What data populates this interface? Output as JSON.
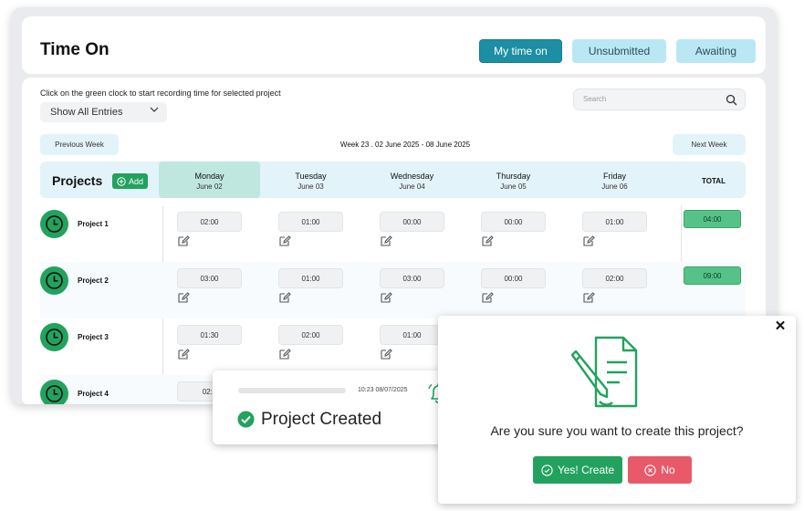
{
  "header": {
    "title": "Time On",
    "tabs": [
      {
        "label": "My time on",
        "active": true
      },
      {
        "label": "Unsubmitted",
        "active": false
      },
      {
        "label": "Awaiting",
        "active": false
      }
    ]
  },
  "toolbar": {
    "hint": "Click on the green clock to start recording time for selected project",
    "filter_value": "Show All Entries",
    "search_placeholder": "Search",
    "prev_week": "Previous Week",
    "next_week": "Next Week",
    "week_label": "Week 23 . 02 June 2025 - 08 June 2025"
  },
  "table": {
    "projects_title": "Projects",
    "add_label": "Add",
    "total_label": "TOTAL",
    "days": [
      {
        "name": "Monday",
        "date": "June 02",
        "active": true
      },
      {
        "name": "Tuesday",
        "date": "June 03",
        "active": false
      },
      {
        "name": "Wednesday",
        "date": "June 04",
        "active": false
      },
      {
        "name": "Thursday",
        "date": "June 05",
        "active": false
      },
      {
        "name": "Friday",
        "date": "June 06",
        "active": false
      }
    ],
    "rows": [
      {
        "project": "Project 1",
        "times": [
          "02:00",
          "01:00",
          "00:00",
          "00:00",
          "01:00"
        ],
        "total": "04:00"
      },
      {
        "project": "Project 2",
        "times": [
          "03:00",
          "01:00",
          "03:00",
          "00:00",
          "02:00"
        ],
        "total": "09:00"
      },
      {
        "project": "Project 3",
        "times": [
          "01:30",
          "02:00",
          "01:00"
        ],
        "total": ""
      },
      {
        "project": "Project 4",
        "times": [
          "02:0"
        ],
        "total": ""
      }
    ]
  },
  "toast": {
    "timestamp": "10:23 08/07/2025",
    "message": "Project Created"
  },
  "dialog": {
    "question": "Are you sure you want to create this project?",
    "yes_label": "Yes! Create",
    "no_label": "No",
    "close_glyph": "✕"
  },
  "colors": {
    "primary": "#1c8fa4",
    "accent_light": "#b9e8f4",
    "green": "#22a25e",
    "total_green": "#57c287",
    "red": "#e8596a"
  }
}
